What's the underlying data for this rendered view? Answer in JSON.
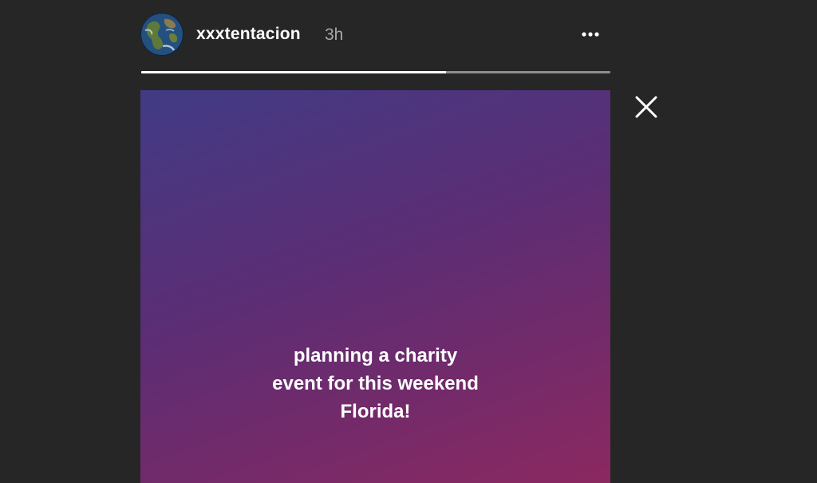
{
  "story": {
    "username": "xxxtentacion",
    "timestamp": "3h",
    "progress": 0.65,
    "caption_lines": [
      "planning a charity",
      "event for this weekend",
      "Florida!"
    ]
  },
  "icons": {
    "avatar": "earth-globe-avatar",
    "more": "more-options-icon",
    "close": "close-icon"
  },
  "colors": {
    "background": "#262626",
    "gradient_start": "#413b85",
    "gradient_mid": "#5c2d74",
    "gradient_end": "#8b2860",
    "progress_fill": "#ffffff",
    "progress_track": "#8e8e8e",
    "timestamp": "#a8a8a8"
  }
}
